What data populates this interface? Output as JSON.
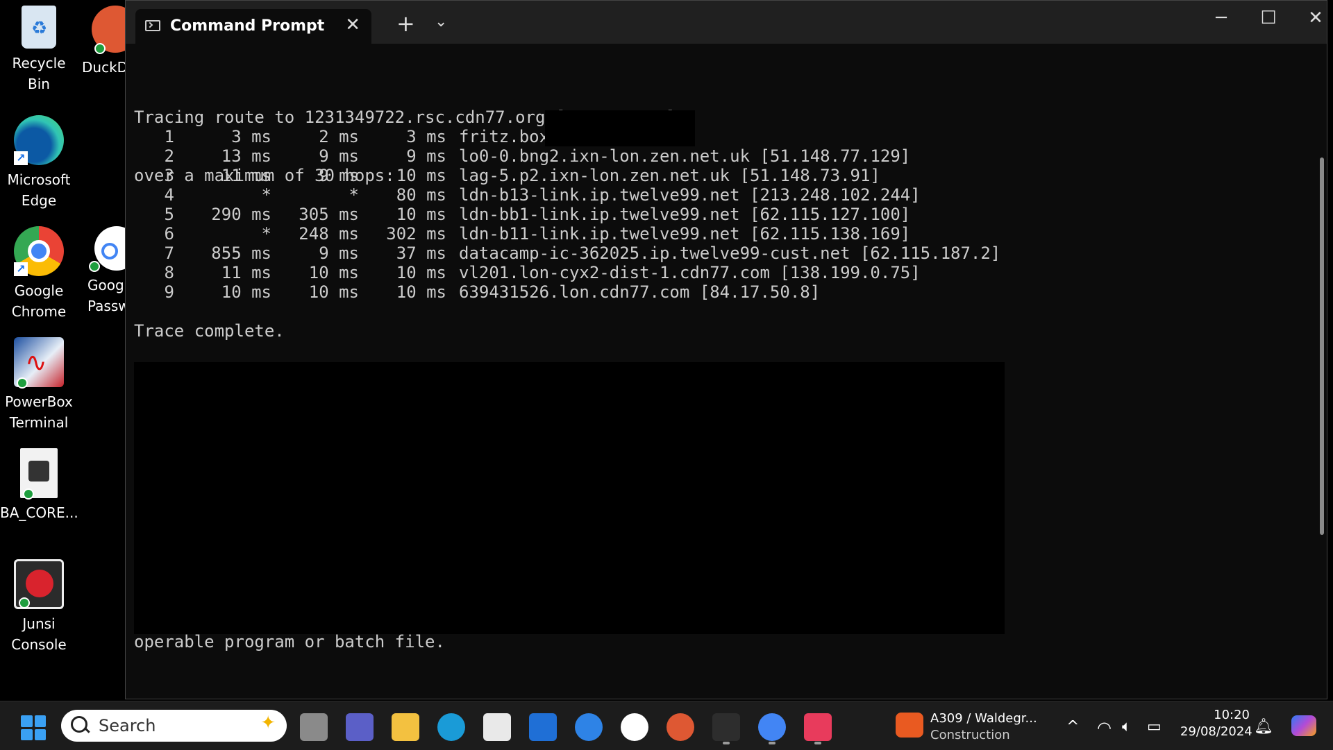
{
  "desktop": {
    "icons": [
      {
        "label": "Recycle Bin",
        "icon": "recycle-bin-icon"
      },
      {
        "label": "DuckD",
        "icon": "duckduckgo-icon"
      },
      {
        "label": "Microsoft\nEdge",
        "icon": "edge-icon"
      },
      {
        "label": "Google\nChrome",
        "icon": "chrome-icon"
      },
      {
        "label": "Goog\nPassw",
        "icon": "google-password-icon"
      },
      {
        "label": "PowerBox\nTerminal",
        "icon": "powerbox-icon"
      },
      {
        "label": "BA_CORE...",
        "icon": "ba-core-icon"
      },
      {
        "label": "Junsi\nConsole",
        "icon": "junsi-icon"
      }
    ]
  },
  "window": {
    "tab_title": "Command Prompt",
    "tab_close": "✕",
    "new_tab": "+",
    "dropdown": "⌄",
    "minimize": "─",
    "maximize": "☐",
    "close": "✕"
  },
  "console": {
    "line1": "Tracing route to 1231349722.rsc.cdn77.org [84.17.50.8]",
    "line2": "over a maximum of 30 hops:",
    "hops": [
      {
        "n": "1",
        "t1": "3 ms",
        "t2": "2 ms",
        "t3": "3 ms",
        "host": "fritz.box"
      },
      {
        "n": "2",
        "t1": "13 ms",
        "t2": "9 ms",
        "t3": "9 ms",
        "host": "lo0-0.bng2.ixn-lon.zen.net.uk [51.148.77.129]"
      },
      {
        "n": "3",
        "t1": "11 ms",
        "t2": "9 ms",
        "t3": "10 ms",
        "host": "lag-5.p2.ixn-lon.zen.net.uk [51.148.73.91]"
      },
      {
        "n": "4",
        "t1": "*",
        "t2": "*",
        "t3": "80 ms",
        "host": "ldn-b13-link.ip.twelve99.net [213.248.102.244]"
      },
      {
        "n": "5",
        "t1": "290 ms",
        "t2": "305 ms",
        "t3": "10 ms",
        "host": "ldn-bb1-link.ip.twelve99.net [62.115.127.100]"
      },
      {
        "n": "6",
        "t1": "*",
        "t2": "248 ms",
        "t3": "302 ms",
        "host": "ldn-b11-link.ip.twelve99.net [62.115.138.169]"
      },
      {
        "n": "7",
        "t1": "855 ms",
        "t2": "9 ms",
        "t3": "37 ms",
        "host": "datacamp-ic-362025.ip.twelve99-cust.net [62.115.187.2]"
      },
      {
        "n": "8",
        "t1": "11 ms",
        "t2": "10 ms",
        "t3": "10 ms",
        "host": "vl201.lon-cyx2-dist-1.cdn77.com [138.199.0.75]"
      },
      {
        "n": "9",
        "t1": "10 ms",
        "t2": "10 ms",
        "t3": "10 ms",
        "host": "639431526.lon.cdn77.com [84.17.50.8]"
      }
    ],
    "trace_complete": "Trace complete.",
    "tail": "operable program or batch file."
  },
  "taskbar": {
    "search_placeholder": "Search",
    "weather_title": "A309 / Waldegr...",
    "weather_sub": "Construction",
    "time": "10:20",
    "date": "29/08/2024",
    "apps": [
      "task-view-icon",
      "teams-icon",
      "file-explorer-icon",
      "edge-icon",
      "store-icon",
      "myhp-icon",
      "help-icon",
      "password-icon",
      "duckduckgo-icon",
      "terminal-icon",
      "chrome-icon",
      "snipping-tool-icon"
    ],
    "tray": {
      "chevron": "^",
      "wifi": "wifi-icon",
      "volume": "volume-icon",
      "battery": "battery-icon",
      "notif": "notification-icon",
      "copilot": "copilot-icon"
    }
  }
}
